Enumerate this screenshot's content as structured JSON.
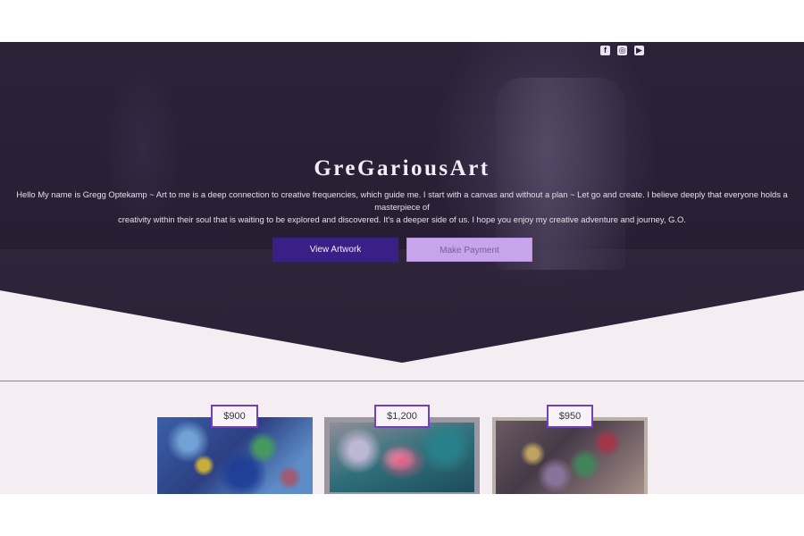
{
  "social": [
    {
      "icon": "facebook-icon",
      "glyph": "f"
    },
    {
      "icon": "instagram-icon",
      "glyph": "◎"
    },
    {
      "icon": "youtube-icon",
      "glyph": "▶"
    }
  ],
  "hero": {
    "title_light": "GreGarious",
    "title_bold": "Art",
    "intro_line1": "Hello My name is Gregg Optekamp ~ Art to me is a deep connection to creative frequencies, which guide me. I start with a canvas and without a plan ~ Let go and create. I believe deeply that everyone holds a masterpiece of",
    "intro_line2": "creativity within their soul that is waiting to be explored and discovered. It's a deeper side of us. I hope you enjoy my creative adventure and journey, G.O."
  },
  "buttons": {
    "view_artwork": "View Artwork",
    "make_payment": "Make Payment"
  },
  "artworks": [
    {
      "price": "$900"
    },
    {
      "price": "$1,200"
    },
    {
      "price": "$950"
    }
  ],
  "colors": {
    "primary_button": "#3a1f86",
    "secondary_button": "#c7a4ec",
    "price_border": "#6f3fc4",
    "hero_bg": "#2a2036",
    "page_bg": "#f4eef3"
  }
}
